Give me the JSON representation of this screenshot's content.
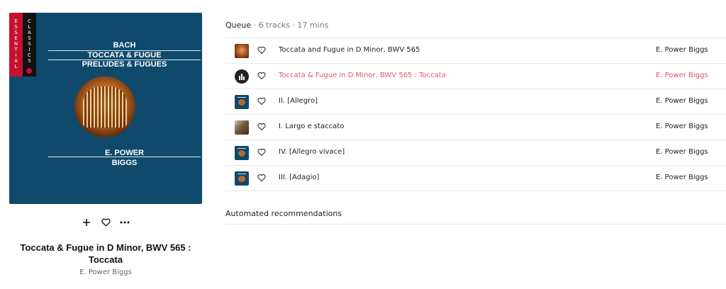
{
  "album_art": {
    "series_vertical_left": "ESSENTIAL",
    "series_vertical_right": "CLASSICS",
    "composer": "BACH",
    "title_line1": "TOCCATA & FUGUE",
    "title_line2": "PRELUDES & FUGUES",
    "artist_line1": "E. POWER",
    "artist_line2": "BIGGS",
    "background_color": "#0f4a6d",
    "accent_color": "#c8102e"
  },
  "controls": {
    "add_icon": "plus-icon",
    "like_icon": "heart-icon",
    "more_icon": "more-horizontal-icon"
  },
  "now_playing": {
    "title": "Toccata & Fugue in D Minor, BWV 565 : Toccata",
    "artist": "E. Power Biggs"
  },
  "queue": {
    "label": "Queue",
    "meta": " · 6 tracks · 17 mins",
    "active_color": "#e0566b",
    "tracks": [
      {
        "title": "Toccata and Fugue in D Minor, BWV 565",
        "artist": "E. Power Biggs",
        "thumb": "organ"
      },
      {
        "title": "Toccata & Fugue in D Minor, BWV 565 : Toccata",
        "artist": "E. Power Biggs",
        "thumb": "playing"
      },
      {
        "title": "II. [Allegro]",
        "artist": "E. Power Biggs",
        "thumb": "album"
      },
      {
        "title": "I. Largo e staccato",
        "artist": "E. Power Biggs",
        "thumb": "photo"
      },
      {
        "title": "IV. [Allegro vivace]",
        "artist": "E. Power Biggs",
        "thumb": "album"
      },
      {
        "title": "III. [Adagio]",
        "artist": "E. Power Biggs",
        "thumb": "album"
      }
    ]
  },
  "recommendations": {
    "label": "Automated recommendations"
  }
}
